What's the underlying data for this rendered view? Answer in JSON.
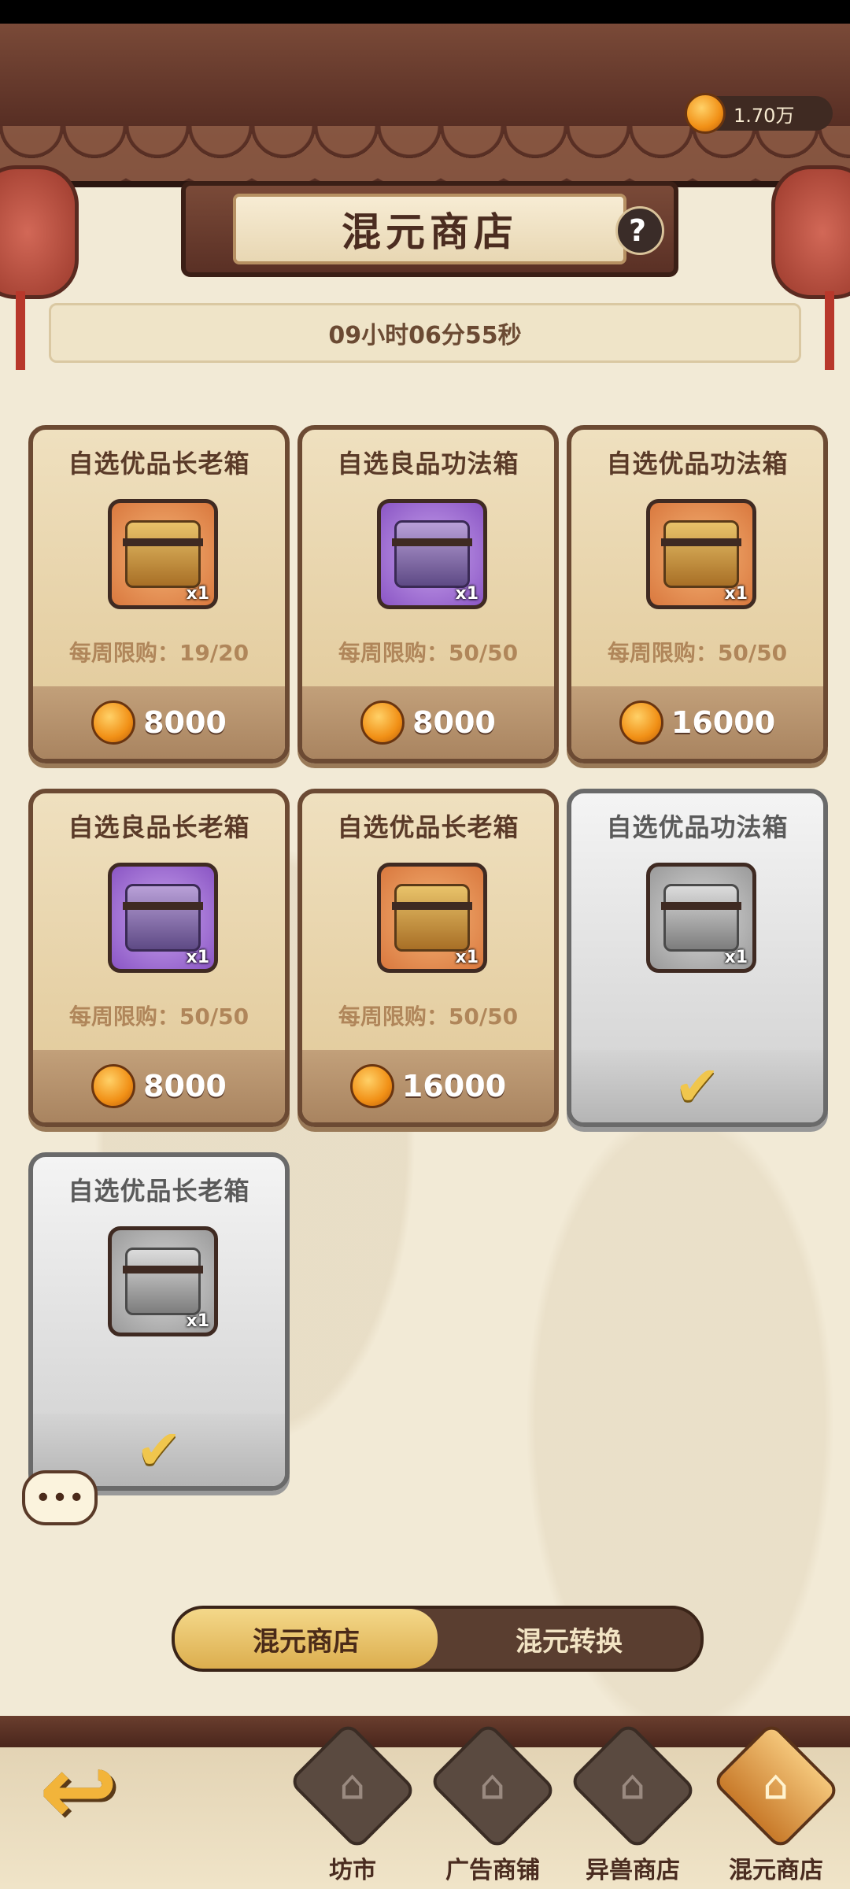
{
  "currency": {
    "amount": "1.70万"
  },
  "header": {
    "title": "混元商店",
    "help": "?"
  },
  "timer": "09小时06分55秒",
  "items": [
    {
      "title": "自选优品长老箱",
      "qty": "x1",
      "limit": "每周限购：19/20",
      "price": "8000",
      "rarity": "orange",
      "state": "available"
    },
    {
      "title": "自选良品功法箱",
      "qty": "x1",
      "limit": "每周限购：50/50",
      "price": "8000",
      "rarity": "purple",
      "state": "available"
    },
    {
      "title": "自选优品功法箱",
      "qty": "x1",
      "limit": "每周限购：50/50",
      "price": "16000",
      "rarity": "orange",
      "state": "available"
    },
    {
      "title": "自选良品长老箱",
      "qty": "x1",
      "limit": "每周限购：50/50",
      "price": "8000",
      "rarity": "purple",
      "state": "available"
    },
    {
      "title": "自选优品长老箱",
      "qty": "x1",
      "limit": "每周限购：50/50",
      "price": "16000",
      "rarity": "orange",
      "state": "available"
    },
    {
      "title": "自选优品功法箱",
      "qty": "x1",
      "state": "purchased"
    },
    {
      "title": "自选优品长老箱",
      "qty": "x1",
      "state": "purchased"
    }
  ],
  "chat": "•••",
  "tabs": [
    {
      "label": "混元商店",
      "active": true
    },
    {
      "label": "混元转换",
      "active": false
    }
  ],
  "nav": [
    {
      "label": "坊市",
      "icon": "market-icon"
    },
    {
      "label": "广告商铺",
      "icon": "ad-shop-icon"
    },
    {
      "label": "异兽商店",
      "icon": "beast-shop-icon"
    },
    {
      "label": "混元商店",
      "icon": "hunyuan-shop-icon",
      "active": true
    }
  ],
  "back_icon": "back-arrow-icon"
}
